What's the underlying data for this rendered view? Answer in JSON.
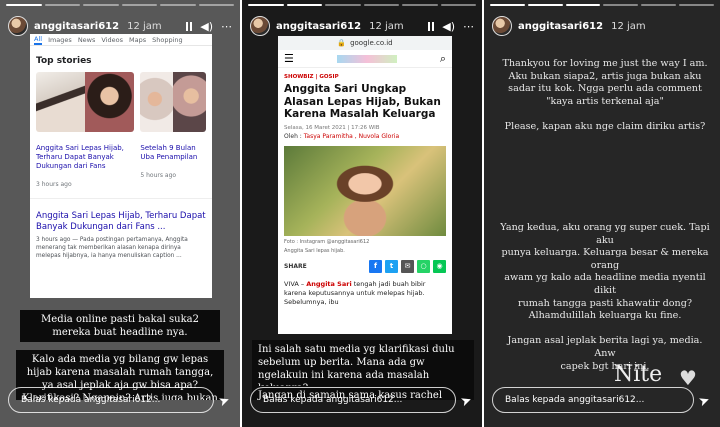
{
  "stories": [
    {
      "username": "anggitasari612",
      "time": "12 jam",
      "reply_placeholder": "Balas kepada anggitasari612...",
      "google": {
        "tabs": [
          "All",
          "Images",
          "News",
          "Videos",
          "Maps",
          "Shopping"
        ],
        "top_stories": "Top stories",
        "card1_title": "Anggita Sari Lepas Hijab, Terharu Dapat Banyak Dukungan dari Fans",
        "card1_time": "3 hours ago",
        "card2_title": "Setelah 9 Bulan Uba Penampilan",
        "card2_time": "5 hours ago",
        "article_title": "Anggita Sari Lepas Hijab, Terharu Dapat Banyak Dukungan dari Fans ...",
        "article_snippet": "3 hours ago — Pada postingan pertamanya, Anggita menerang tak memberikan alasan kenapa dirinya melepas hijabnya, ia hanya menuliskan caption ..."
      },
      "captions": [
        "Media online pasti bakal suka2 mereka buat headline nya.",
        "Kalo ada media yg bilang gw lepas hijab karena masalah rumah tangga, ya asal jeplak aja gw bisa apa? Klarifikasi? Ngapain? Artis juga bukan kok"
      ]
    },
    {
      "username": "anggitasari612",
      "time": "12 jam",
      "reply_placeholder": "Balas kepada anggitasari612...",
      "article": {
        "url": "google.co.id",
        "breadcrumb": "SHOWBIZ  |  GOSIP",
        "title": "Anggita Sari Ungkap Alasan Lepas Hijab, Bukan Karena Masalah Keluarga",
        "date": "Selasa, 16 Maret 2021 | 17:26 WIB",
        "author_prefix": "Oleh :",
        "author": "Tasya Paramitha , Nuvola Gloria",
        "photo_credit": "Foto : Instagram @anggitasari612",
        "photo_caption": "Anggita Sari lepas hijab.",
        "share_label": "SHARE",
        "body_prefix": "VIVA – ",
        "body_name": "Anggita Sari",
        "body": " tengah jadi buah bibir karena keputusannya untuk melepas hijab. Sebelumnya, ibu"
      },
      "captions": [
        "Ini salah satu media yg klarifikasi dulu sebelum up berita. Mana ada gw ngelakuin ini karena ada masalah keluarga?",
        "Jangan di samain sama kasus rachel vemya dll lah gw rasa nggak se terkenal mereka so please"
      ]
    },
    {
      "username": "anggitasari612",
      "time": "12 jam",
      "reply_placeholder": "Balas kepada anggitasari612...",
      "text1": "Thankyou for loving me just the way I am.\nAku bukan siapa2, artis juga bukan aku\nsadar itu kok. Ngga perlu ada comment\n\"kaya artis terkenal aja\"\n\nPlease, kapan aku nge claim diriku artis?",
      "text2": "Yang kedua, aku orang yg super cuek. Tapi aku\npunya keluarga. Keluarga besar & mereka orang\nawam yg kalo ada headline media nyentil dikit\nrumah tangga pasti khawatir dong?\nAlhamdulillah keluarga ku fine.\n\nJangan asal jeplak berita lagi ya, media. Anw\ncapek bgt hari ini.",
      "nite": "Nite"
    }
  ]
}
